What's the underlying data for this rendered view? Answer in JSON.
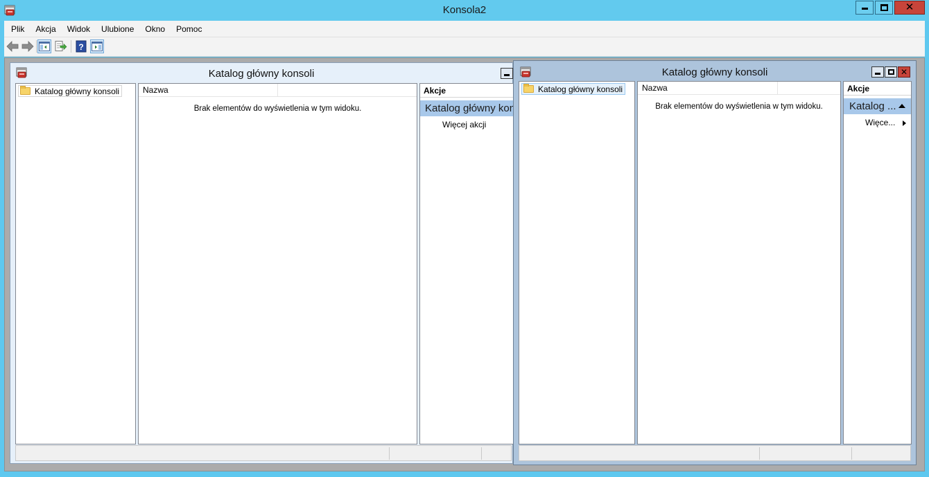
{
  "window": {
    "title": "Konsola2"
  },
  "menu": {
    "items": [
      "Plik",
      "Akcja",
      "Widok",
      "Ulubione",
      "Okno",
      "Pomoc"
    ]
  },
  "toolbar": {
    "icons": [
      "back-arrow-icon",
      "forward-arrow-icon",
      "show-hide-tree-icon",
      "export-list-icon",
      "help-icon",
      "show-hide-action-pane-icon"
    ]
  },
  "child_windows": [
    {
      "title": "Katalog główny konsoli",
      "tree_item": "Katalog główny konsoli",
      "column_header": "Nazwa",
      "empty_message": "Brak elementów do wyświetlenia w tym widoku.",
      "actions": {
        "header": "Akcje",
        "section": "Katalog główny konsoli",
        "item": "Więcej akcji"
      }
    },
    {
      "title": "Katalog główny konsoli",
      "tree_item": "Katalog główny konsoli",
      "column_header": "Nazwa",
      "empty_message": "Brak elementów do wyświetlenia w tym widoku.",
      "actions": {
        "header": "Akcje",
        "section": "Katalog ...",
        "item": "Więce..."
      }
    }
  ],
  "colors": {
    "titlebar": "#62caee",
    "action_band": "#a8c8ea",
    "close_button": "#c7443a",
    "inactive_child_frame": "#e6f0fa",
    "active_child_frame": "#adc4dc"
  }
}
